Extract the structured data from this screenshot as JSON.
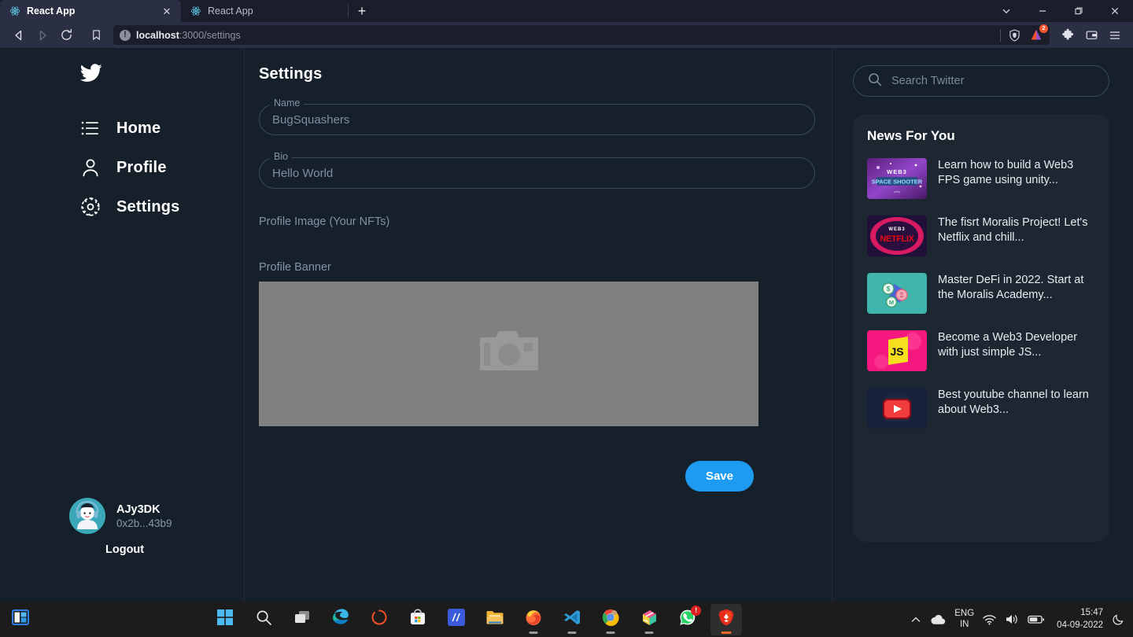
{
  "browser": {
    "tabs": [
      {
        "title": "React App",
        "icon": "react-icon",
        "active": true
      },
      {
        "title": "React App",
        "icon": "react-icon",
        "active": false
      }
    ],
    "new_tab_label": "+",
    "close_tab_label": "✕",
    "window_controls": {
      "tab_search": "⌄",
      "minimize": "—",
      "maximize": "❐",
      "close": "✕"
    },
    "nav": {
      "back": "◁",
      "forward": "▷",
      "reload": "↻",
      "bookmark": "bookmark-icon"
    },
    "url": {
      "warning_glyph": "!",
      "host": "localhost",
      "path": ":3000/settings",
      "full": "localhost:3000/settings"
    },
    "brave_rewards_badge": "2",
    "toolbar_icons": [
      "shield-icon",
      "brave-rewards-icon",
      "extensions-icon",
      "wallet-icon",
      "menu-icon"
    ]
  },
  "sidebar": {
    "logo": "twitter-bird-icon",
    "items": [
      {
        "label": "Home",
        "icon": "list-icon"
      },
      {
        "label": "Profile",
        "icon": "person-icon"
      },
      {
        "label": "Settings",
        "icon": "gear-icon"
      }
    ],
    "profile": {
      "name": "AJy3DK",
      "address": "0x2b...43b9",
      "logout_label": "Logout"
    }
  },
  "main": {
    "title": "Settings",
    "fields": [
      {
        "legend": "Name",
        "value": "BugSquashers"
      },
      {
        "legend": "Bio",
        "value": "Hello World"
      }
    ],
    "nft_label": "Profile Image (Your NFTs)",
    "banner_label": "Profile Banner",
    "banner_placeholder_icon": "broken-image-camera-icon",
    "save_label": "Save",
    "accent_color": "#1d9bf0"
  },
  "right": {
    "search_placeholder": "Search Twitter",
    "search_icon": "search-icon",
    "news_heading": "News For You",
    "news": [
      {
        "text": "Learn how to build a Web3 FPS game using unity...",
        "thumb": "web3-space-shooter-thumb"
      },
      {
        "text": "The fisrt Moralis Project! Let's Netflix and chill...",
        "thumb": "web3-netflix-thumb"
      },
      {
        "text": "Master DeFi in 2022. Start at the Moralis Academy...",
        "thumb": "defi-coins-thumb"
      },
      {
        "text": "Become a Web3 Developer with just simple JS...",
        "thumb": "js-thumb"
      },
      {
        "text": "Best youtube channel to learn about Web3...",
        "thumb": "youtube-thumb"
      }
    ]
  },
  "taskbar": {
    "widgets_icon": "widgets-icon",
    "apps": [
      {
        "name": "start-button",
        "icon": "windows-start-icon"
      },
      {
        "name": "search-button",
        "icon": "search-icon"
      },
      {
        "name": "task-view-button",
        "icon": "task-view-icon"
      },
      {
        "name": "edge-app",
        "icon": "edge-icon"
      },
      {
        "name": "unknown-orange-app",
        "icon": "orange-circle-icon"
      },
      {
        "name": "microsoft-store-app",
        "icon": "store-icon"
      },
      {
        "name": "blue-m-app",
        "icon": "blue-m-icon"
      },
      {
        "name": "file-explorer-app",
        "icon": "folder-icon"
      },
      {
        "name": "firefox-app",
        "icon": "firefox-icon",
        "running": true
      },
      {
        "name": "vscode-app",
        "icon": "vscode-icon",
        "running": true
      },
      {
        "name": "chrome-app",
        "icon": "chrome-icon",
        "running": true
      },
      {
        "name": "paint-app",
        "icon": "paint-icon",
        "running": true
      },
      {
        "name": "whatsapp-app",
        "icon": "whatsapp-icon",
        "badge": "!"
      },
      {
        "name": "brave-app",
        "icon": "brave-icon",
        "running": true,
        "active": true
      }
    ],
    "tray": {
      "overflow": "∧",
      "cloud": "onedrive-icon",
      "lang_line1": "ENG",
      "lang_line2": "IN",
      "wifi": "wifi-icon",
      "volume": "volume-icon",
      "battery": "battery-icon",
      "time": "15:47",
      "date": "04-09-2022",
      "notification": "moon-icon"
    }
  }
}
